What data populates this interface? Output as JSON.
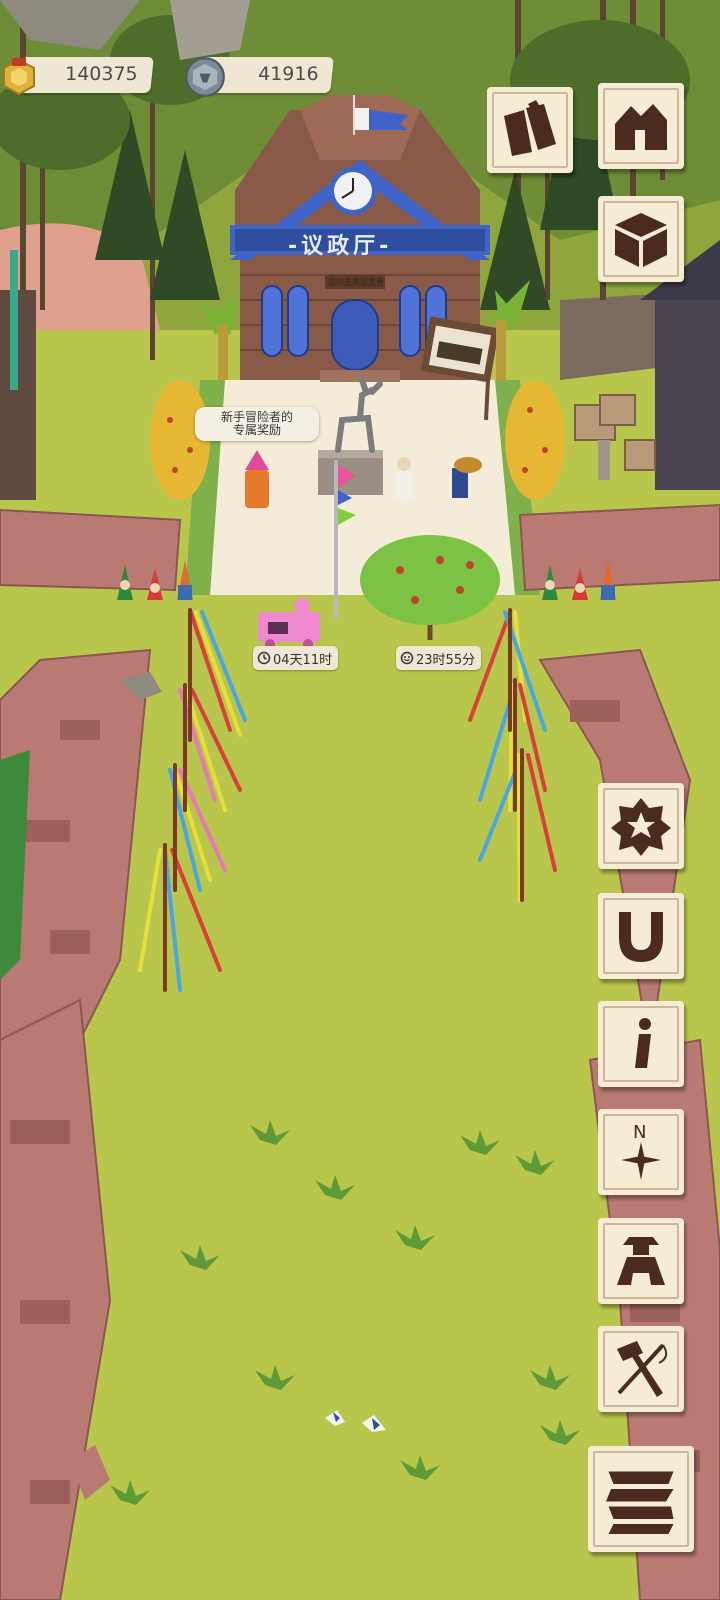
{
  "hud": {
    "gold_value": "140375",
    "silver_value": "41916"
  },
  "town_hall": {
    "title": "-议政厅-",
    "sign_text": "您的选票很重要"
  },
  "speech_bubble": {
    "line1": "新手冒险者的",
    "line2": "专属奖励"
  },
  "timers": {
    "left": "04天11时",
    "right": "23时55分"
  },
  "side_buttons": [
    {
      "id": "scrolls",
      "icon": "scrolls-icon"
    },
    {
      "id": "home",
      "icon": "house-icon"
    },
    {
      "id": "box",
      "icon": "crate-icon"
    },
    {
      "id": "badge",
      "icon": "badge-icon"
    },
    {
      "id": "horseshoe",
      "icon": "horseshoe-icon"
    },
    {
      "id": "info",
      "icon": "info-icon",
      "label": "i"
    },
    {
      "id": "compass",
      "icon": "compass-icon",
      "label": "N"
    },
    {
      "id": "character",
      "icon": "character-icon"
    },
    {
      "id": "craft",
      "icon": "hammer-needle-icon"
    },
    {
      "id": "menu",
      "icon": "stack-menu-icon"
    }
  ],
  "colors": {
    "grass": "#b9c64c",
    "stone": "#b87a72",
    "button_bg": "#f6ecd5",
    "button_icon": "#4a2b1d",
    "hall_wood": "#8a5a49",
    "hall_trim": "#3f63c8"
  }
}
